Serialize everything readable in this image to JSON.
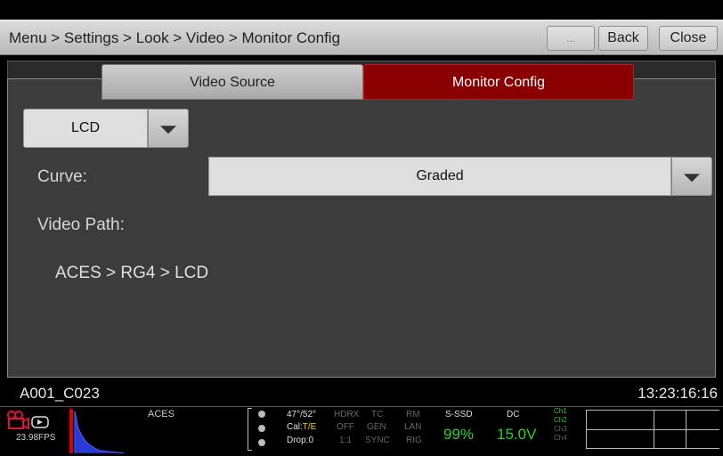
{
  "header": {
    "breadcrumb": "Menu > Settings > Look > Video > Monitor Config",
    "more_label": "...",
    "back_label": "Back",
    "close_label": "Close"
  },
  "tabs": [
    {
      "label": "Video Source",
      "active": false
    },
    {
      "label": "Monitor Config",
      "active": true
    }
  ],
  "monitor_select": {
    "value": "LCD"
  },
  "curve": {
    "label": "Curve:",
    "value": "Graded"
  },
  "video_path": {
    "label": "Video Path:",
    "value": "ACES > RG4 > LCD"
  },
  "status": {
    "clip_name": "A001_C023",
    "timecode": "13:23:16:16",
    "fps": "23.98FPS",
    "color_space": "ACES",
    "temp": "47°/52°",
    "cal_label": "Cal:",
    "cal_value": "T/E",
    "drop": "Drop:0",
    "hdrx": "HDRX",
    "off": "OFF",
    "ratio": "1:1",
    "tc": "TC",
    "gen": "GEN",
    "sync": "SYNC",
    "rm": "RM",
    "lan": "LAN",
    "rig": "RIG",
    "media_label": "S-SSD",
    "media_value": "99%",
    "power_label": "DC",
    "power_value": "15.0V",
    "channels": [
      "Ch1",
      "Ch2",
      "Ch3",
      "Ch4"
    ]
  },
  "colors": {
    "accent_red": "#8a0000",
    "status_green": "#2bd12b",
    "status_yellow": "#ffd400"
  }
}
